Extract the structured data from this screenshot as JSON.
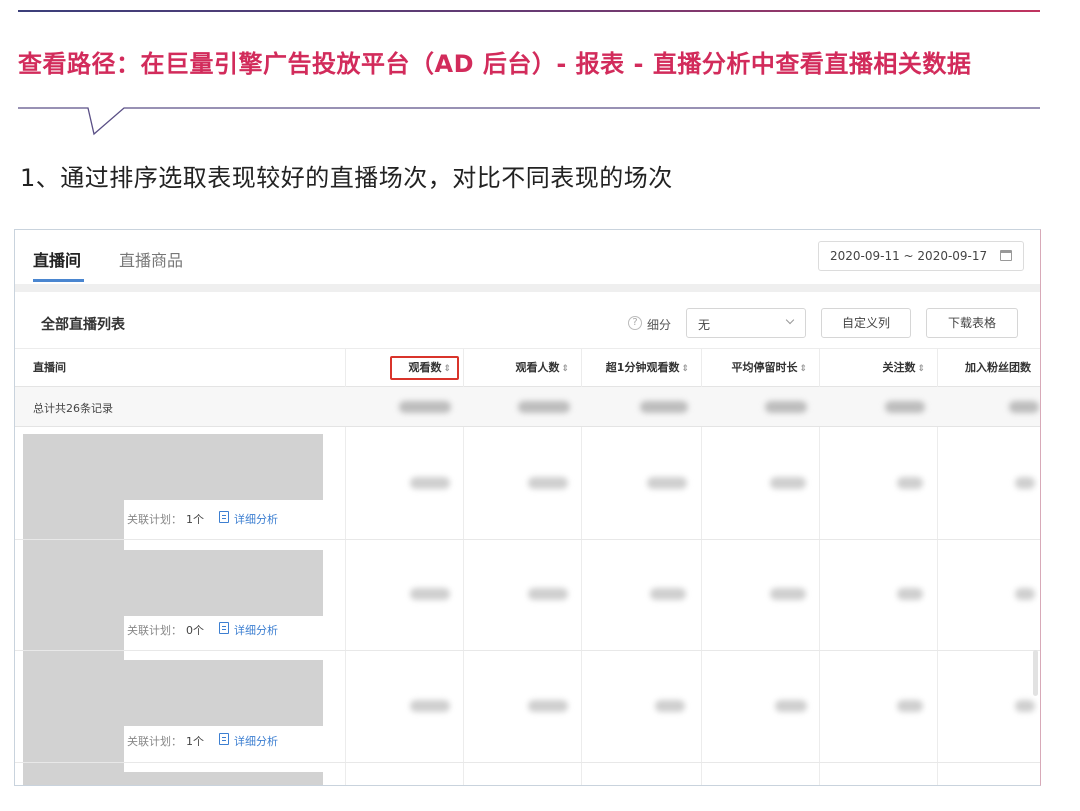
{
  "article": {
    "path_title": "查看路径：在巨量引擎广告投放平台（AD 后台）- 报表 - 直播分析中查看直播相关数据",
    "step_text": "1、通过排序选取表现较好的直播场次，对比不同表现的场次"
  },
  "colors": {
    "accent": "#d22b5b",
    "highlight": "#d9342b",
    "link": "#3d7fd1",
    "tab_active": "#4a86d0"
  },
  "screenshot": {
    "tabs": [
      {
        "label": "直播间",
        "active": true
      },
      {
        "label": "直播商品",
        "active": false
      }
    ],
    "date_range": "2020-09-11 ~ 2020-09-17",
    "list_title": "全部直播列表",
    "segment": {
      "label": "细分",
      "value": "无"
    },
    "buttons": {
      "customize_columns": "自定义列",
      "download_table": "下载表格"
    },
    "table": {
      "columns": [
        {
          "label": "直播间",
          "sortable": false,
          "highlighted": false
        },
        {
          "label": "观看数",
          "sortable": true,
          "highlighted": true
        },
        {
          "label": "观看人数",
          "sortable": true,
          "highlighted": false
        },
        {
          "label": "超1分钟观看数",
          "sortable": true,
          "highlighted": false
        },
        {
          "label": "平均停留时长",
          "sortable": true,
          "highlighted": false
        },
        {
          "label": "关注数",
          "sortable": true,
          "highlighted": false
        },
        {
          "label": "加入粉丝团数",
          "sortable": false,
          "highlighted": false
        }
      ],
      "sort_icon": "⇕",
      "total_label": "总计共26条记录",
      "rows": [
        {
          "related_plan_label": "关联计划：",
          "related_plan_count": "1个",
          "detail_link": "详细分析"
        },
        {
          "related_plan_label": "关联计划：",
          "related_plan_count": "0个",
          "detail_link": "详细分析"
        },
        {
          "related_plan_label": "关联计划：",
          "related_plan_count": "1个",
          "detail_link": "详细分析"
        }
      ]
    }
  }
}
